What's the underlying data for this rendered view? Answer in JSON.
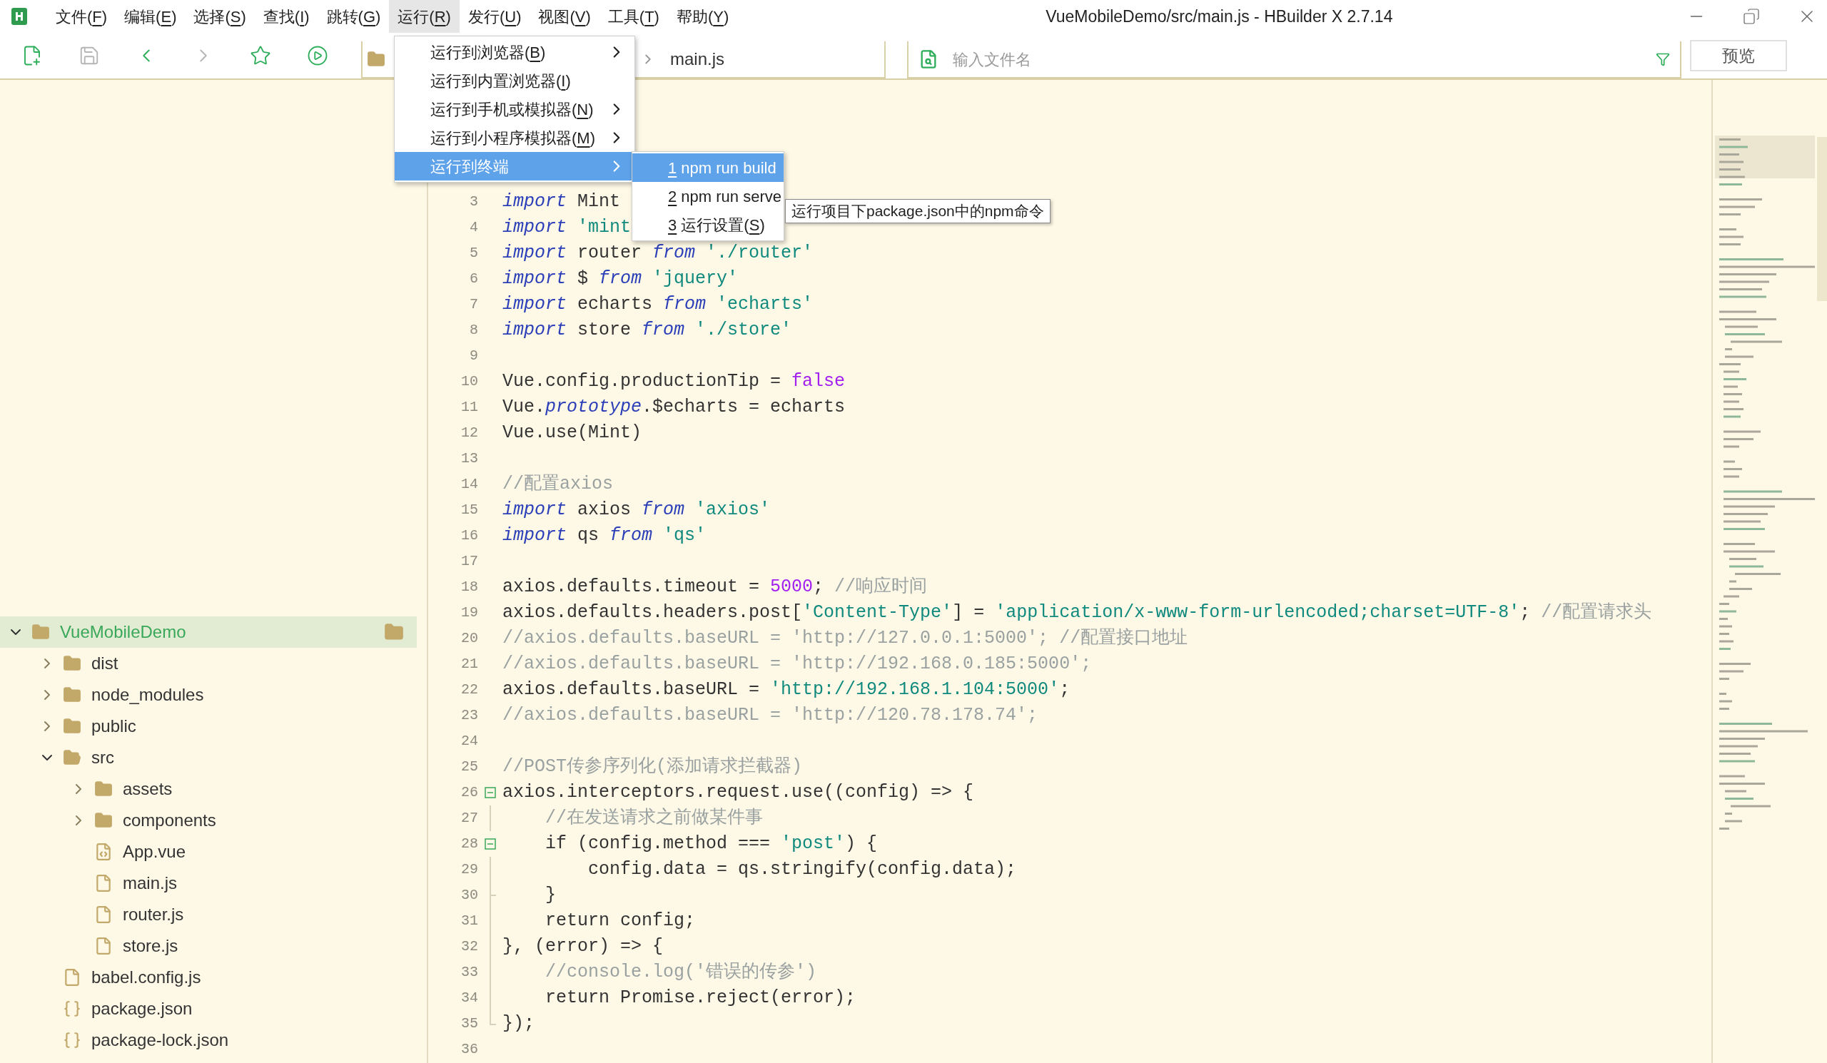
{
  "window": {
    "title": "VueMobileDemo/src/main.js - HBuilder X 2.7.14"
  },
  "menu_bar": [
    {
      "selected": false,
      "parts": [
        {
          "text": "文件(",
          "underlined": false
        },
        {
          "text": "F",
          "underlined": true
        },
        {
          "text": ")",
          "underlined": false
        }
      ]
    },
    {
      "selected": false,
      "parts": [
        {
          "text": "编辑(",
          "underlined": false
        },
        {
          "text": "E",
          "underlined": true
        },
        {
          "text": ")",
          "underlined": false
        }
      ]
    },
    {
      "selected": false,
      "parts": [
        {
          "text": "选择(",
          "underlined": false
        },
        {
          "text": "S",
          "underlined": true
        },
        {
          "text": ")",
          "underlined": false
        }
      ]
    },
    {
      "selected": false,
      "parts": [
        {
          "text": "查找(",
          "underlined": false
        },
        {
          "text": "I",
          "underlined": true
        },
        {
          "text": ")",
          "underlined": false
        }
      ]
    },
    {
      "selected": false,
      "parts": [
        {
          "text": "跳转(",
          "underlined": false
        },
        {
          "text": "G",
          "underlined": true
        },
        {
          "text": ")",
          "underlined": false
        }
      ]
    },
    {
      "selected": true,
      "parts": [
        {
          "text": "运行(",
          "underlined": false
        },
        {
          "text": "R",
          "underlined": true
        },
        {
          "text": ")",
          "underlined": false
        }
      ]
    },
    {
      "selected": false,
      "parts": [
        {
          "text": "发行(",
          "underlined": false
        },
        {
          "text": "U",
          "underlined": true
        },
        {
          "text": ")",
          "underlined": false
        }
      ]
    },
    {
      "selected": false,
      "parts": [
        {
          "text": "视图(",
          "underlined": false
        },
        {
          "text": "V",
          "underlined": true
        },
        {
          "text": ")",
          "underlined": false
        }
      ]
    },
    {
      "selected": false,
      "parts": [
        {
          "text": "工具(",
          "underlined": false
        },
        {
          "text": "T",
          "underlined": true
        },
        {
          "text": ")",
          "underlined": false
        }
      ]
    },
    {
      "selected": false,
      "parts": [
        {
          "text": "帮助(",
          "underlined": false
        },
        {
          "text": "Y",
          "underlined": true
        },
        {
          "text": ")",
          "underlined": false
        }
      ]
    }
  ],
  "toolbar": [
    {
      "disabled": false
    },
    {
      "disabled": true
    },
    {
      "disabled": false
    },
    {
      "disabled": true
    },
    {
      "disabled": false
    },
    {
      "disabled": false
    }
  ],
  "breadcrumb": "main.js",
  "file_search": {
    "placeholder": "输入文件名"
  },
  "preview_button": "预览",
  "run_menu": [
    {
      "selected": false,
      "submenu": true,
      "parts": [
        {
          "text": "运行到浏览器(",
          "underlined": false
        },
        {
          "text": "B",
          "underlined": true
        },
        {
          "text": ")",
          "underlined": false
        }
      ]
    },
    {
      "selected": false,
      "submenu": false,
      "parts": [
        {
          "text": "运行到内置浏览器(",
          "underlined": false
        },
        {
          "text": "I",
          "underlined": true
        },
        {
          "text": ")",
          "underlined": false
        }
      ]
    },
    {
      "selected": false,
      "submenu": true,
      "parts": [
        {
          "text": "运行到手机或模拟器(",
          "underlined": false
        },
        {
          "text": "N",
          "underlined": true
        },
        {
          "text": ")",
          "underlined": false
        }
      ]
    },
    {
      "selected": false,
      "submenu": true,
      "parts": [
        {
          "text": "运行到小程序模拟器(",
          "underlined": false
        },
        {
          "text": "M",
          "underlined": true
        },
        {
          "text": ")",
          "underlined": false
        }
      ]
    },
    {
      "selected": true,
      "submenu": true,
      "parts": [
        {
          "text": "运行到终端",
          "underlined": false
        }
      ]
    }
  ],
  "terminal_submenu": [
    {
      "selected": true,
      "parts": [
        {
          "text": "1",
          "underlined": true
        },
        {
          "text": " npm run build",
          "underlined": false
        }
      ]
    },
    {
      "selected": false,
      "parts": [
        {
          "text": "2",
          "underlined": true
        },
        {
          "text": " npm run serve",
          "underlined": false
        }
      ]
    },
    {
      "selected": false,
      "parts": [
        {
          "text": "3",
          "underlined": true
        },
        {
          "text": " 运行设置(",
          "underlined": false
        },
        {
          "text": "S",
          "underlined": true
        },
        {
          "text": ")",
          "underlined": false
        }
      ]
    }
  ],
  "tooltip": "运行项目下package.json中的npm命令",
  "project_tree": [
    {
      "name": "VueMobileDemo",
      "kind": "project",
      "selected": true,
      "expanded": true,
      "children": [
        {
          "name": "dist",
          "kind": "folder",
          "selected": false,
          "expanded": false
        },
        {
          "name": "node_modules",
          "kind": "folder",
          "selected": false,
          "expanded": false
        },
        {
          "name": "public",
          "kind": "folder",
          "selected": false,
          "expanded": false
        },
        {
          "name": "src",
          "kind": "folder",
          "selected": false,
          "expanded": true,
          "children": [
            {
              "name": "assets",
              "kind": "folder",
              "selected": false,
              "expanded": false
            },
            {
              "name": "components",
              "kind": "folder",
              "selected": false,
              "expanded": false
            },
            {
              "name": "App.vue",
              "kind": "vue",
              "selected": false
            },
            {
              "name": "main.js",
              "kind": "js",
              "selected": false
            },
            {
              "name": "router.js",
              "kind": "js",
              "selected": false
            },
            {
              "name": "store.js",
              "kind": "js",
              "selected": false
            }
          ]
        },
        {
          "name": "babel.config.js",
          "kind": "js",
          "selected": false
        },
        {
          "name": "package.json",
          "kind": "json",
          "selected": false
        },
        {
          "name": "package-lock.json",
          "kind": "json",
          "selected": false
        }
      ]
    }
  ],
  "code_lines": [
    {
      "number": "3",
      "tokens": [
        {
          "kind": "keyword",
          "text": "import"
        },
        {
          "kind": "plain",
          "text": " Mint"
        }
      ]
    },
    {
      "number": "4",
      "tokens": [
        {
          "kind": "keyword",
          "text": "import"
        },
        {
          "kind": "string",
          "text": " 'mint"
        }
      ]
    },
    {
      "number": "5",
      "tokens": [
        {
          "kind": "keyword",
          "text": "import"
        },
        {
          "kind": "plain",
          "text": " router "
        },
        {
          "kind": "keyword",
          "text": "from"
        },
        {
          "kind": "string",
          "text": " './router'"
        }
      ]
    },
    {
      "number": "6",
      "tokens": [
        {
          "kind": "keyword",
          "text": "import"
        },
        {
          "kind": "plain",
          "text": " $ "
        },
        {
          "kind": "keyword",
          "text": "from"
        },
        {
          "kind": "string",
          "text": " 'jquery'"
        }
      ]
    },
    {
      "number": "7",
      "tokens": [
        {
          "kind": "keyword",
          "text": "import"
        },
        {
          "kind": "plain",
          "text": " echarts "
        },
        {
          "kind": "keyword",
          "text": "from"
        },
        {
          "kind": "string",
          "text": " 'echarts'"
        }
      ]
    },
    {
      "number": "8",
      "tokens": [
        {
          "kind": "keyword",
          "text": "import"
        },
        {
          "kind": "plain",
          "text": " store "
        },
        {
          "kind": "keyword",
          "text": "from"
        },
        {
          "kind": "string",
          "text": " './store'"
        }
      ]
    },
    {
      "number": "9"
    },
    {
      "number": "10",
      "tokens": [
        {
          "kind": "plain",
          "text": "Vue.config.productionTip = "
        },
        {
          "kind": "number",
          "text": "false"
        }
      ]
    },
    {
      "number": "11",
      "tokens": [
        {
          "kind": "plain",
          "text": "Vue."
        },
        {
          "kind": "keyword",
          "text": "prototype"
        },
        {
          "kind": "plain",
          "text": ".$echarts = echarts"
        }
      ]
    },
    {
      "number": "12",
      "tokens": [
        {
          "kind": "plain",
          "text": "Vue.use(Mint)"
        }
      ]
    },
    {
      "number": "13"
    },
    {
      "number": "14",
      "tokens": [
        {
          "kind": "comment",
          "text": "//配置axios"
        }
      ]
    },
    {
      "number": "15",
      "tokens": [
        {
          "kind": "keyword",
          "text": "import"
        },
        {
          "kind": "plain",
          "text": " axios "
        },
        {
          "kind": "keyword",
          "text": "from"
        },
        {
          "kind": "string",
          "text": " 'axios'"
        }
      ]
    },
    {
      "number": "16",
      "tokens": [
        {
          "kind": "keyword",
          "text": "import"
        },
        {
          "kind": "plain",
          "text": " qs "
        },
        {
          "kind": "keyword",
          "text": "from"
        },
        {
          "kind": "string",
          "text": " 'qs'"
        }
      ]
    },
    {
      "number": "17"
    },
    {
      "number": "18",
      "tokens": [
        {
          "kind": "plain",
          "text": "axios.defaults.timeout = "
        },
        {
          "kind": "number",
          "text": "5000"
        },
        {
          "kind": "plain",
          "text": ";"
        },
        {
          "kind": "comment",
          "text": " //响应时间"
        }
      ]
    },
    {
      "number": "19",
      "tokens": [
        {
          "kind": "plain",
          "text": "axios.defaults.headers.post["
        },
        {
          "kind": "string",
          "text": "'Content-Type'"
        },
        {
          "kind": "plain",
          "text": "] = "
        },
        {
          "kind": "string",
          "text": "'application/x-www-form-urlencoded;charset=UTF-8'"
        },
        {
          "kind": "plain",
          "text": ";"
        },
        {
          "kind": "comment",
          "text": " //配置请求头"
        }
      ]
    },
    {
      "number": "20",
      "tokens": [
        {
          "kind": "comment",
          "text": "//axios.defaults.baseURL = 'http://127.0.0.1:5000'; //配置接口地址"
        }
      ]
    },
    {
      "number": "21",
      "tokens": [
        {
          "kind": "comment",
          "text": "//axios.defaults.baseURL = 'http://192.168.0.185:5000';"
        }
      ]
    },
    {
      "number": "22",
      "tokens": [
        {
          "kind": "plain",
          "text": "axios.defaults.baseURL = "
        },
        {
          "kind": "string",
          "text": "'http://192.168.1.104:5000'"
        },
        {
          "kind": "plain",
          "text": ";"
        }
      ]
    },
    {
      "number": "23",
      "tokens": [
        {
          "kind": "comment",
          "text": "//axios.defaults.baseURL = 'http://120.78.178.74';"
        }
      ]
    },
    {
      "number": "24"
    },
    {
      "number": "25",
      "tokens": [
        {
          "kind": "comment",
          "text": "//POST传参序列化(添加请求拦截器)"
        }
      ]
    },
    {
      "number": "26",
      "kind": "open",
      "tokens": [
        {
          "kind": "plain",
          "text": "axios.interceptors.request.use((config) => {"
        }
      ]
    },
    {
      "number": "27",
      "kind": "line",
      "tokens": [
        {
          "kind": "comment",
          "text": "    //在发送请求之前做某件事"
        }
      ]
    },
    {
      "number": "28",
      "kind": "open",
      "tokens": [
        {
          "kind": "plain",
          "text": "    if (config.method === "
        },
        {
          "kind": "string",
          "text": "'post'"
        },
        {
          "kind": "plain",
          "text": ") {"
        }
      ]
    },
    {
      "number": "29",
      "kind": "line",
      "tokens": [
        {
          "kind": "plain",
          "text": "        config.data = qs.stringify(config.data);"
        }
      ]
    },
    {
      "number": "30",
      "kind": "tee",
      "tokens": [
        {
          "kind": "plain",
          "text": "    }"
        }
      ]
    },
    {
      "number": "31",
      "kind": "line",
      "tokens": [
        {
          "kind": "plain",
          "text": "    return config;"
        }
      ]
    },
    {
      "number": "32",
      "kind": "line",
      "tokens": [
        {
          "kind": "plain",
          "text": "}, (error) => {"
        }
      ]
    },
    {
      "number": "33",
      "kind": "line",
      "tokens": [
        {
          "kind": "comment",
          "text": "    //console.log('错误的传参')"
        }
      ]
    },
    {
      "number": "34",
      "kind": "line",
      "tokens": [
        {
          "kind": "plain",
          "text": "    return Promise.reject(error);"
        }
      ]
    },
    {
      "number": "35",
      "kind": "end",
      "tokens": [
        {
          "kind": "plain",
          "text": "});"
        }
      ]
    },
    {
      "number": "36"
    }
  ]
}
